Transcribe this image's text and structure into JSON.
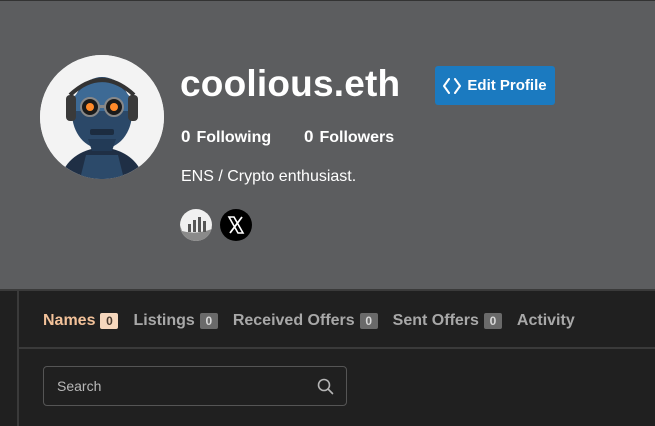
{
  "profile": {
    "username": "coolious.eth",
    "edit_label": "Edit Profile",
    "following_count": "0",
    "following_label": "Following",
    "followers_count": "0",
    "followers_label": "Followers",
    "bio": "ENS / Crypto enthusiast.",
    "socials": [
      {
        "icon": "chart-bars-icon"
      },
      {
        "icon": "x-logo-icon"
      }
    ]
  },
  "tabs": [
    {
      "label": "Names",
      "count": "0",
      "active": true
    },
    {
      "label": "Listings",
      "count": "0"
    },
    {
      "label": "Received Offers",
      "count": "0"
    },
    {
      "label": "Sent Offers",
      "count": "0"
    },
    {
      "label": "Activity"
    }
  ],
  "search": {
    "placeholder": "Search"
  },
  "colors": {
    "header_bg": "#5c5d5f",
    "page_bg": "#202020",
    "accent_button": "#1b7ac0",
    "active_tab": "#f3c29a"
  }
}
